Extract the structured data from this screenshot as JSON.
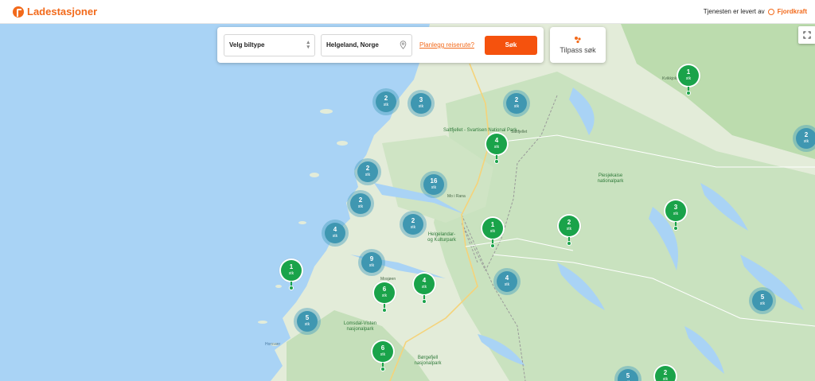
{
  "header": {
    "app_name": "Ladestasjoner",
    "provider_text": "Tjenesten er levert av",
    "provider_name": "Fjordkraft"
  },
  "search": {
    "vehicle_select_value": "Velg biltype",
    "location_value": "Helgeland, Norge",
    "plan_route_link": "Planlegg reiserute?",
    "search_button": "Søk"
  },
  "filter": {
    "label": "Tilpass søk"
  },
  "marker_unit": "stk",
  "clusters": [
    {
      "count": "2"
    },
    {
      "count": "3"
    },
    {
      "count": "2"
    },
    {
      "count": "2"
    },
    {
      "count": "2"
    },
    {
      "count": "16"
    },
    {
      "count": "2"
    },
    {
      "count": "2"
    },
    {
      "count": "4"
    },
    {
      "count": "9"
    },
    {
      "count": "4"
    },
    {
      "count": "5"
    },
    {
      "count": "5"
    },
    {
      "count": "5"
    }
  ],
  "stations": [
    {
      "count": "1"
    },
    {
      "count": "4"
    },
    {
      "count": "1"
    },
    {
      "count": "2"
    },
    {
      "count": "3"
    },
    {
      "count": "1"
    },
    {
      "count": "6"
    },
    {
      "count": "4"
    },
    {
      "count": "6"
    },
    {
      "count": "2"
    }
  ],
  "map_labels": [
    "Saltfjellet - Svartisen National Park",
    "Saltfjellet",
    "Piesjekaise nationalpark",
    "Lomsdal-Visten nasjonalpark",
    "Børgefjell nasjonalpark",
    "Helgelandar- og Kulturpark",
    "Horsvær",
    "Kvikkjokk",
    "Mo i Rana",
    "Mosjøen"
  ]
}
